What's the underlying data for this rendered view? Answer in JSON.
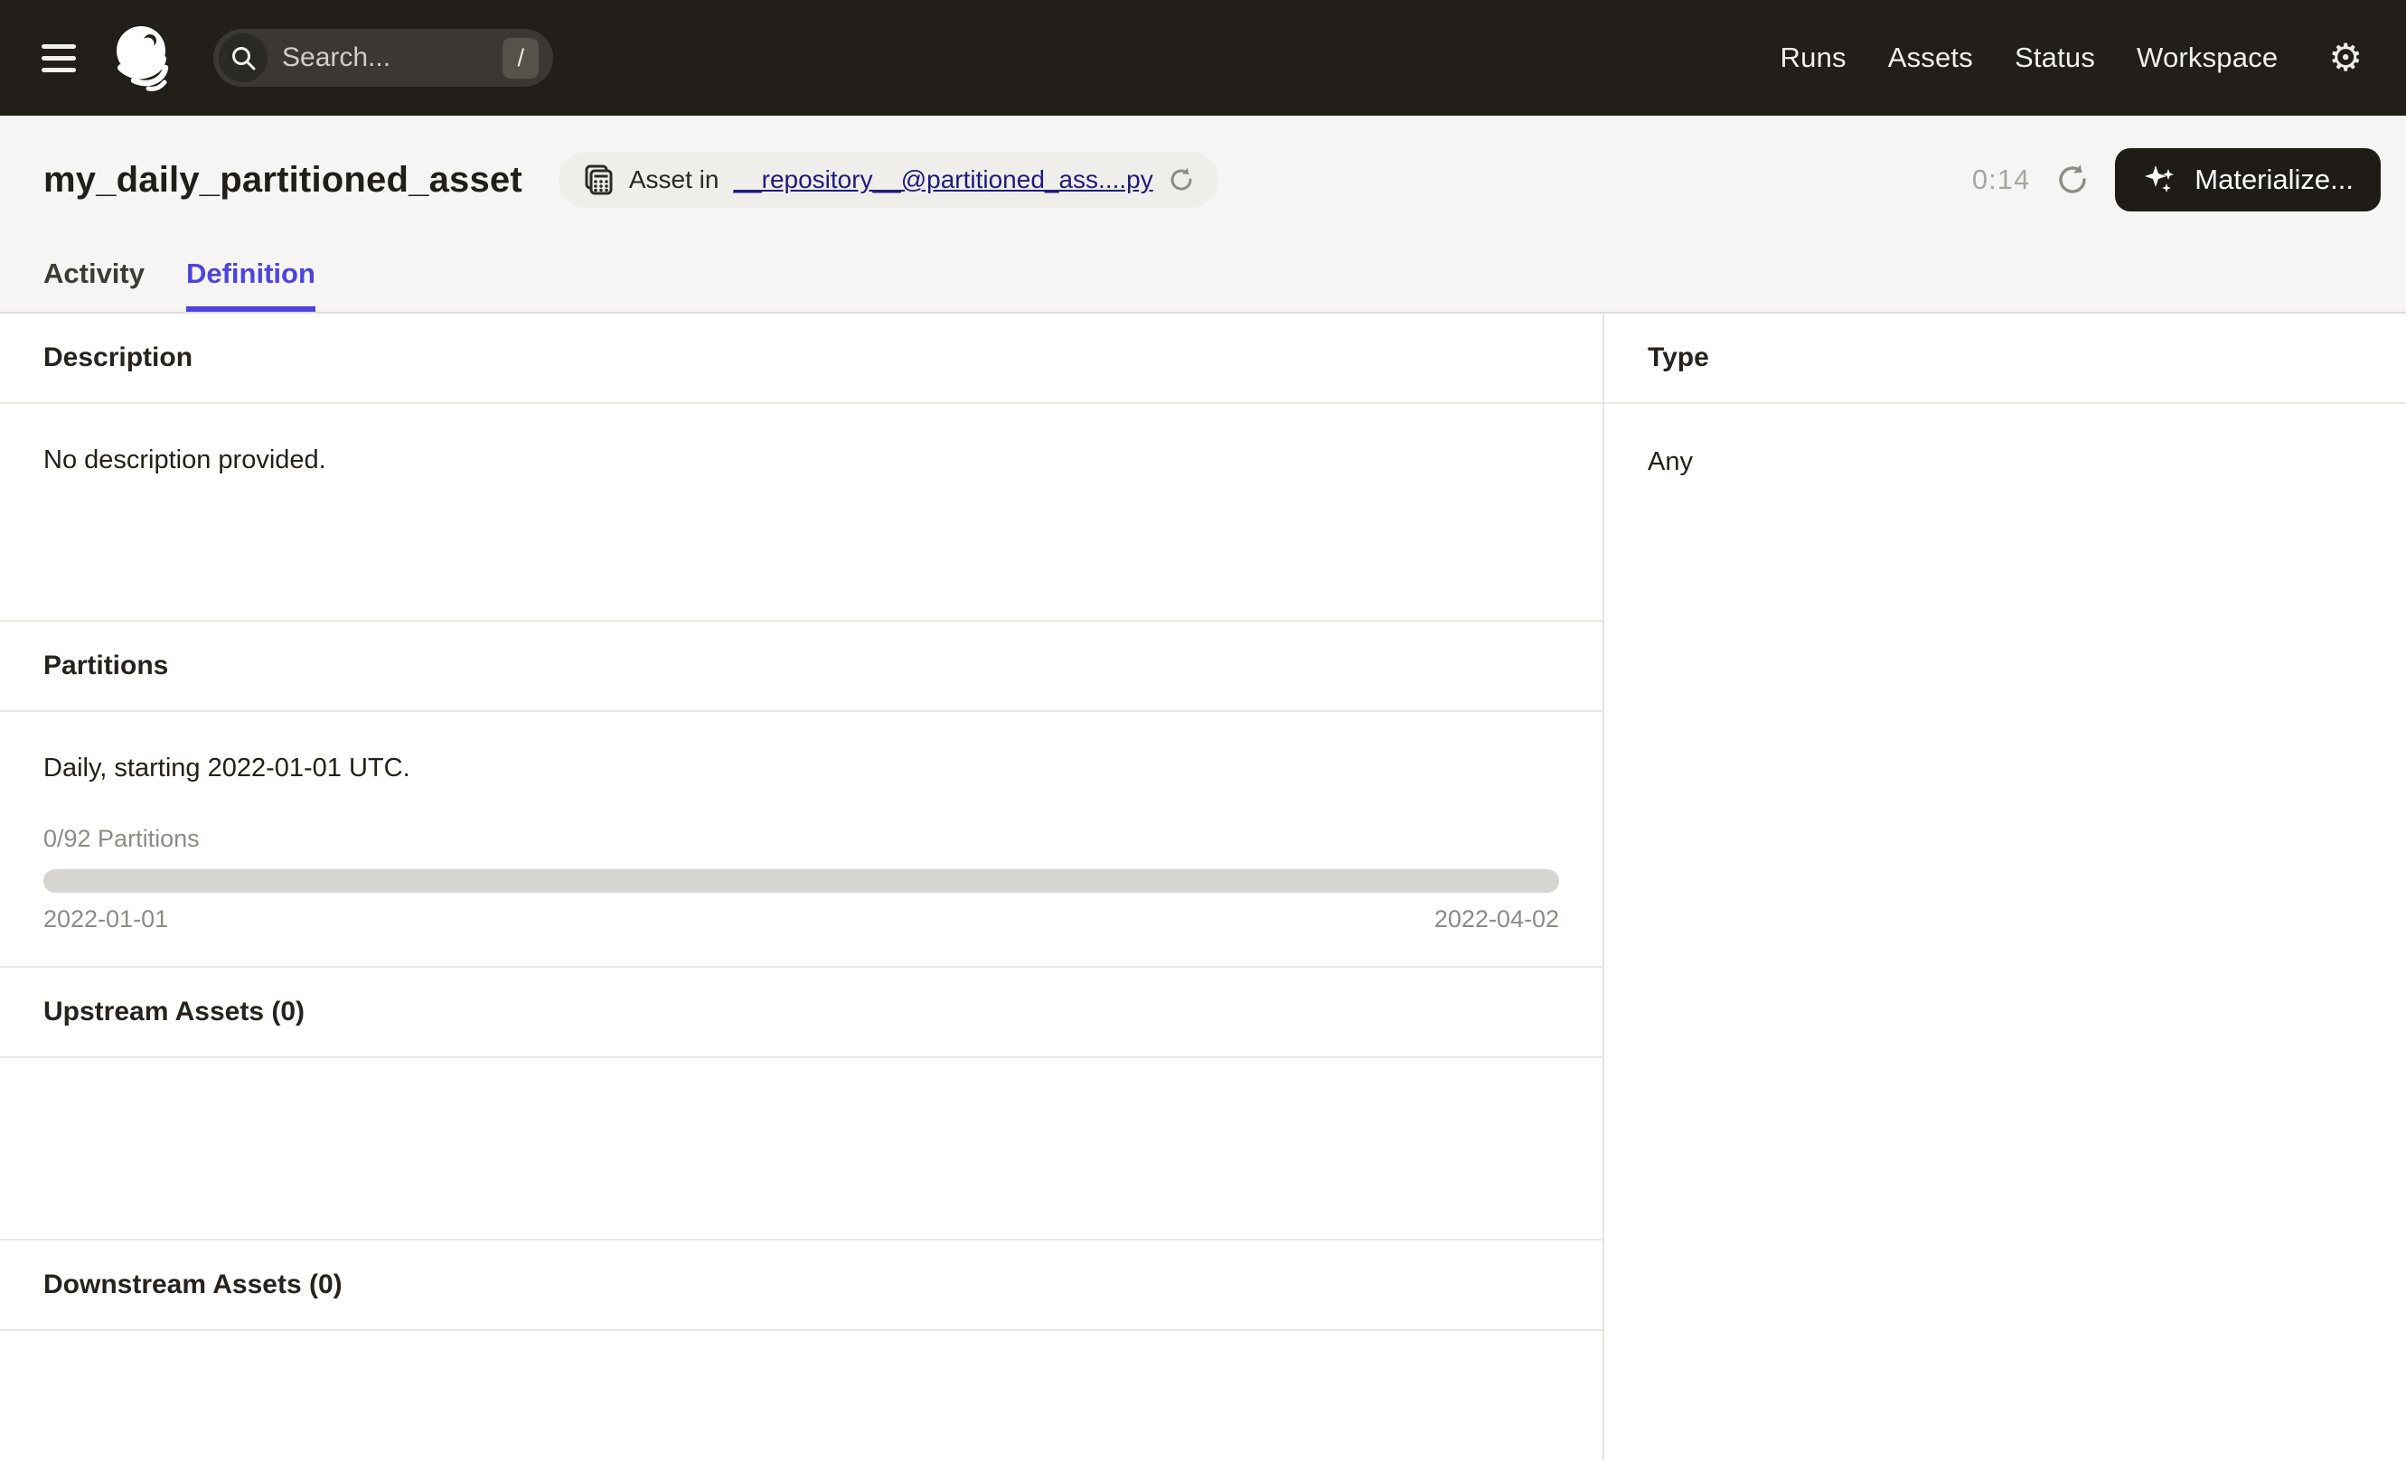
{
  "nav": {
    "search_placeholder": "Search...",
    "search_shortcut": "/",
    "links": [
      {
        "label": "Runs"
      },
      {
        "label": "Assets"
      },
      {
        "label": "Status"
      },
      {
        "label": "Workspace"
      }
    ],
    "gear_glyph": "⚙"
  },
  "header": {
    "title": "my_daily_partitioned_asset",
    "asset_tag": {
      "prefix": "Asset in",
      "link": "__repository__@partitioned_ass....py"
    },
    "timer": "0:14",
    "materialize_label": "Materialize..."
  },
  "tabs": [
    {
      "label": "Activity",
      "active": false
    },
    {
      "label": "Definition",
      "active": true
    }
  ],
  "main": {
    "description": {
      "heading": "Description",
      "body": "No description provided."
    },
    "partitions": {
      "heading": "Partitions",
      "summary": "Daily, starting 2022-01-01 UTC.",
      "progress_label": "0/92 Partitions",
      "progress_percent": 0,
      "range_start": "2022-01-01",
      "range_end": "2022-04-02"
    },
    "upstream": {
      "heading": "Upstream Assets (0)"
    },
    "downstream": {
      "heading": "Downstream Assets (0)"
    }
  },
  "side_panel": {
    "type_heading": "Type",
    "type_value": "Any"
  },
  "icons": {
    "menu": "hamburger",
    "logo": "dagster-octopus",
    "search": "magnifier",
    "settings": "gear",
    "asset_tag": "repo-grid",
    "reload": "circular-arrow",
    "refresh": "circular-arrow",
    "materialize": "sparkles"
  },
  "colors": {
    "nav_bg": "#221F1A",
    "band_bg": "#F6F5F3",
    "accent": "#4F43DD",
    "link": "#201B79",
    "progress_track": "#D7D5D2",
    "muted_text": "#8E8B86"
  }
}
